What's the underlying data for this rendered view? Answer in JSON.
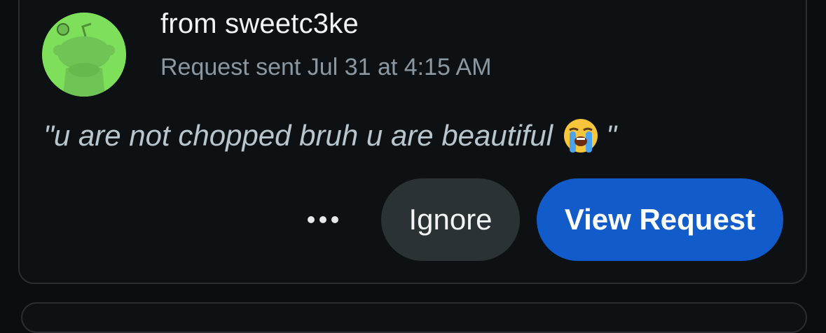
{
  "request": {
    "sender_label": "from sweetc3ke",
    "sent_time": "Request sent Jul 31 at 4:15 AM",
    "message_prefix": "\"u are not chopped bruh u are beautiful",
    "message_suffix": "\"",
    "message_emoji": "loudly-crying-face-icon"
  },
  "actions": {
    "more_icon": "more-horizontal-icon",
    "ignore_label": "Ignore",
    "view_request_label": "View Request"
  },
  "colors": {
    "avatar_bg": "#7ee05a",
    "primary_button": "#115bca",
    "secondary_button": "#2b3236"
  }
}
